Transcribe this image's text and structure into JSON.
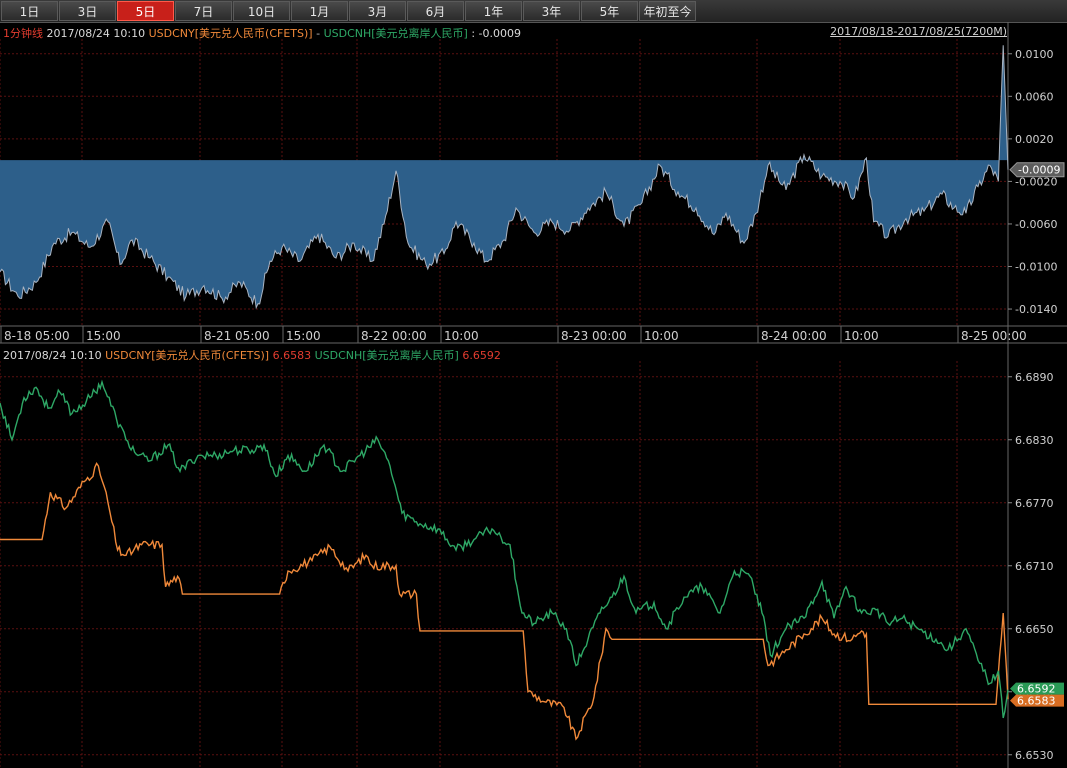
{
  "tabs": [
    {
      "label": "1日",
      "active": false
    },
    {
      "label": "3日",
      "active": false
    },
    {
      "label": "5日",
      "active": true
    },
    {
      "label": "7日",
      "active": false
    },
    {
      "label": "10日",
      "active": false
    },
    {
      "label": "1月",
      "active": false
    },
    {
      "label": "3月",
      "active": false
    },
    {
      "label": "6月",
      "active": false
    },
    {
      "label": "1年",
      "active": false
    },
    {
      "label": "3年",
      "active": false
    },
    {
      "label": "5年",
      "active": false
    },
    {
      "label": "年初至今",
      "active": false
    }
  ],
  "top_header": {
    "interval": "1分钟线",
    "datetime": "2017/08/24 10:10",
    "series_a": "USDCNY[美元兑人民币(CFETS)]",
    "minus": "-",
    "series_b": "USDCNH[美元兑离岸人民币]",
    "value": ": -0.0009",
    "range": "2017/08/18-2017/08/25(7200M)"
  },
  "bottom_header": {
    "datetime": "2017/08/24 10:10",
    "cny_label": "USDCNY[美元兑人民币(CFETS)]",
    "cny_value": "6.6583",
    "cnh_label": "USDCNH[美元兑离岸人民币]",
    "cnh_value": "6.6592"
  },
  "colors": {
    "accent_red": "#c8201a",
    "spread_fill": "#2d5f8a",
    "spread_line": "#a9b4c2",
    "cny_orange": "#f0893a",
    "cnh_green": "#2ea866",
    "grid_red": "#5a1010"
  },
  "chart_data": [
    {
      "type": "area",
      "title": "USDCNY[美元兑人民币(CFETS)] - USDCNH[美元兑离岸人民币]",
      "ylim": [
        -0.0155,
        0.0112
      ],
      "y_ticks": [
        "0.0100",
        "0.0060",
        "0.0020",
        "-0.0020",
        "-0.0060",
        "-0.0100",
        "-0.0140"
      ],
      "x_ticks": [
        "8-18 05:00",
        "15:00",
        "8-21 05:00",
        "15:00",
        "8-22 00:00",
        "10:00",
        "8-23 00:00",
        "10:00",
        "8-24 00:00",
        "10:00",
        "8-25 00:00"
      ],
      "grid": true,
      "last_value": "-0.0009",
      "series": [
        {
          "name": "USDCNY-USDCNH",
          "points": [
            [
              0,
              -0.0105
            ],
            [
              15,
              -0.0128
            ],
            [
              30,
              -0.0115
            ],
            [
              45,
              -0.0078
            ],
            [
              60,
              -0.0068
            ],
            [
              75,
              -0.0082
            ],
            [
              90,
              -0.0058
            ],
            [
              100,
              -0.0098
            ],
            [
              110,
              -0.0075
            ],
            [
              125,
              -0.0092
            ],
            [
              140,
              -0.011
            ],
            [
              155,
              -0.0128
            ],
            [
              170,
              -0.0118
            ],
            [
              185,
              -0.013
            ],
            [
              200,
              -0.0115
            ],
            [
              215,
              -0.0135
            ],
            [
              225,
              -0.0095
            ],
            [
              235,
              -0.0082
            ],
            [
              250,
              -0.0095
            ],
            [
              265,
              -0.007
            ],
            [
              280,
              -0.0092
            ],
            [
              295,
              -0.0078
            ],
            [
              310,
              -0.0095
            ],
            [
              320,
              -0.006
            ],
            [
              330,
              -0.001
            ],
            [
              340,
              -0.0078
            ],
            [
              355,
              -0.0098
            ],
            [
              370,
              -0.0088
            ],
            [
              380,
              -0.0058
            ],
            [
              395,
              -0.0078
            ],
            [
              405,
              -0.0095
            ],
            [
              420,
              -0.0075
            ],
            [
              430,
              -0.0045
            ],
            [
              445,
              -0.0068
            ],
            [
              460,
              -0.0058
            ],
            [
              475,
              -0.0066
            ],
            [
              490,
              -0.0045
            ],
            [
              505,
              -0.003
            ],
            [
              520,
              -0.0062
            ],
            [
              535,
              -0.004
            ],
            [
              550,
              -0.0005
            ],
            [
              565,
              -0.003
            ],
            [
              580,
              -0.0045
            ],
            [
              595,
              -0.007
            ],
            [
              605,
              -0.005
            ],
            [
              620,
              -0.0078
            ],
            [
              630,
              -0.005
            ],
            [
              640,
              -0.0005
            ],
            [
              655,
              -0.0028
            ],
            [
              670,
              0.0005
            ],
            [
              685,
              -0.0015
            ],
            [
              700,
              -0.002
            ],
            [
              712,
              -0.0035
            ],
            [
              722,
              0.0002
            ],
            [
              728,
              -0.0058
            ],
            [
              740,
              -0.0072
            ],
            [
              755,
              -0.0055
            ],
            [
              770,
              -0.0048
            ],
            [
              785,
              -0.0032
            ],
            [
              795,
              -0.0045
            ],
            [
              805,
              -0.005
            ],
            [
              815,
              -0.0025
            ],
            [
              825,
              -0.0005
            ],
            [
              832,
              -0.002
            ],
            [
              836,
              0.0108
            ],
            [
              840,
              -0.0009
            ]
          ]
        }
      ]
    },
    {
      "type": "line",
      "title": "USDCNY / USDCNH",
      "ylim": [
        6.6525,
        6.6905
      ],
      "y_ticks": [
        "6.6890",
        "6.6830",
        "6.6770",
        "6.6710",
        "6.6650",
        "6.6590",
        "6.6530"
      ],
      "grid": true,
      "series": [
        {
          "name": "USDCNY[美元兑人民币(CFETS)]",
          "last_value": "6.6583",
          "points": [
            [
              0,
              6.6735
            ],
            [
              35,
              6.6735
            ],
            [
              42,
              6.678
            ],
            [
              55,
              6.6765
            ],
            [
              70,
              6.679
            ],
            [
              82,
              6.6805
            ],
            [
              90,
              6.677
            ],
            [
              98,
              6.6725
            ],
            [
              105,
              6.672
            ],
            [
              118,
              6.673
            ],
            [
              135,
              6.673
            ],
            [
              138,
              6.669
            ],
            [
              148,
              6.67
            ],
            [
              152,
              6.6683
            ],
            [
              200,
              6.6683
            ],
            [
              233,
              6.6683
            ],
            [
              240,
              6.6705
            ],
            [
              260,
              6.6715
            ],
            [
              275,
              6.6728
            ],
            [
              290,
              6.6705
            ],
            [
              305,
              6.672
            ],
            [
              310,
              6.671
            ],
            [
              330,
              6.671
            ],
            [
              333,
              6.6683
            ],
            [
              347,
              6.6683
            ],
            [
              350,
              6.6648
            ],
            [
              436,
              6.6648
            ],
            [
              440,
              6.659
            ],
            [
              455,
              6.658
            ],
            [
              470,
              6.6575
            ],
            [
              480,
              6.6545
            ],
            [
              495,
              6.6585
            ],
            [
              505,
              6.665
            ],
            [
              510,
              6.664
            ],
            [
              636,
              6.664
            ],
            [
              640,
              6.6615
            ],
            [
              655,
              6.663
            ],
            [
              670,
              6.6645
            ],
            [
              685,
              6.666
            ],
            [
              695,
              6.6645
            ],
            [
              710,
              6.664
            ],
            [
              718,
              6.6648
            ],
            [
              722,
              6.6645
            ],
            [
              724,
              6.6578
            ],
            [
              830,
              6.6578
            ],
            [
              836,
              6.6665
            ],
            [
              840,
              6.6583
            ]
          ]
        },
        {
          "name": "USDCNH[美元兑离岸人民币]",
          "last_value": "6.6592",
          "points": [
            [
              0,
              6.6865
            ],
            [
              10,
              6.683
            ],
            [
              20,
              6.687
            ],
            [
              30,
              6.688
            ],
            [
              40,
              6.686
            ],
            [
              50,
              6.6875
            ],
            [
              60,
              6.6855
            ],
            [
              75,
              6.687
            ],
            [
              85,
              6.6885
            ],
            [
              97,
              6.685
            ],
            [
              105,
              6.683
            ],
            [
              115,
              6.6815
            ],
            [
              125,
              6.681
            ],
            [
              140,
              6.6825
            ],
            [
              150,
              6.68
            ],
            [
              165,
              6.6815
            ],
            [
              180,
              6.6815
            ],
            [
              195,
              6.682
            ],
            [
              210,
              6.682
            ],
            [
              220,
              6.6825
            ],
            [
              230,
              6.6795
            ],
            [
              240,
              6.6815
            ],
            [
              255,
              6.68
            ],
            [
              270,
              6.6825
            ],
            [
              285,
              6.68
            ],
            [
              300,
              6.6815
            ],
            [
              315,
              6.683
            ],
            [
              325,
              6.6805
            ],
            [
              335,
              6.676
            ],
            [
              350,
              6.675
            ],
            [
              365,
              6.6745
            ],
            [
              380,
              6.6725
            ],
            [
              395,
              6.6735
            ],
            [
              410,
              6.6745
            ],
            [
              425,
              6.673
            ],
            [
              435,
              6.6665
            ],
            [
              445,
              6.6655
            ],
            [
              460,
              6.6665
            ],
            [
              472,
              6.665
            ],
            [
              480,
              6.6615
            ],
            [
              490,
              6.664
            ],
            [
              500,
              6.6665
            ],
            [
              510,
              6.668
            ],
            [
              520,
              6.67
            ],
            [
              530,
              6.6665
            ],
            [
              545,
              6.6675
            ],
            [
              555,
              6.665
            ],
            [
              570,
              6.668
            ],
            [
              585,
              6.669
            ],
            [
              600,
              6.6665
            ],
            [
              612,
              6.6705
            ],
            [
              625,
              6.67
            ],
            [
              635,
              6.6665
            ],
            [
              642,
              6.6625
            ],
            [
              655,
              6.665
            ],
            [
              670,
              6.666
            ],
            [
              685,
              6.6695
            ],
            [
              695,
              6.666
            ],
            [
              705,
              6.669
            ],
            [
              718,
              6.6665
            ],
            [
              730,
              6.6668
            ],
            [
              740,
              6.6655
            ],
            [
              752,
              6.666
            ],
            [
              765,
              6.665
            ],
            [
              780,
              6.664
            ],
            [
              790,
              6.663
            ],
            [
              805,
              6.665
            ],
            [
              815,
              6.662
            ],
            [
              825,
              6.6598
            ],
            [
              832,
              6.661
            ],
            [
              836,
              6.6565
            ],
            [
              840,
              6.6592
            ]
          ]
        }
      ]
    }
  ]
}
